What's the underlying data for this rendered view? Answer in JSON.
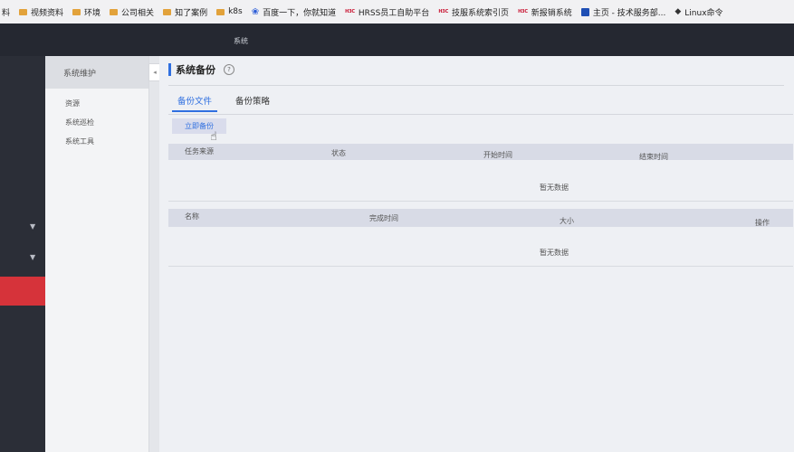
{
  "bookmarks": [
    {
      "label": "料",
      "icon": "none"
    },
    {
      "label": "视频资料",
      "icon": "folder-icon"
    },
    {
      "label": "环境",
      "icon": "folder-icon"
    },
    {
      "label": "公司相关",
      "icon": "folder-icon"
    },
    {
      "label": "知了案例",
      "icon": "folder-icon"
    },
    {
      "label": "k8s",
      "icon": "folder-icon"
    },
    {
      "label": "百度一下，你就知道",
      "icon": "baidu-paw-icon"
    },
    {
      "label": "HRSS员工自助平台",
      "icon": "hbc-icon"
    },
    {
      "label": "技服系统索引页",
      "icon": "hbc-icon"
    },
    {
      "label": "新报销系统",
      "icon": "hbc-icon"
    },
    {
      "label": "主页 - 技术服务部...",
      "icon": "confluence-icon"
    },
    {
      "label": "Linux命令",
      "icon": "diamond-icon"
    }
  ],
  "icons": {
    "hbc_text": "H3C"
  },
  "header": {
    "title": "系统"
  },
  "subnav": {
    "title": "系统维护",
    "items": [
      {
        "label": "资源"
      },
      {
        "label": "系统巡检"
      },
      {
        "label": "系统工具"
      }
    ]
  },
  "page": {
    "title": "系统备份",
    "help": "?",
    "tabs": [
      {
        "label": "备份文件",
        "active": true
      },
      {
        "label": "备份策略",
        "active": false
      }
    ],
    "backup_button": "立即备份",
    "tasks_table": {
      "columns": [
        "任务来源",
        "状态",
        "开始时间",
        "结束时间"
      ],
      "empty_text": "暂无数据"
    },
    "files_table": {
      "columns": [
        "名称",
        "完成时间",
        "大小",
        "操作"
      ],
      "empty_text": "暂无数据"
    }
  },
  "colors": {
    "accent": "#2f6fe0",
    "header_bg": "#252831",
    "nav_active": "#d6333a",
    "folder": "#e2a23b"
  }
}
